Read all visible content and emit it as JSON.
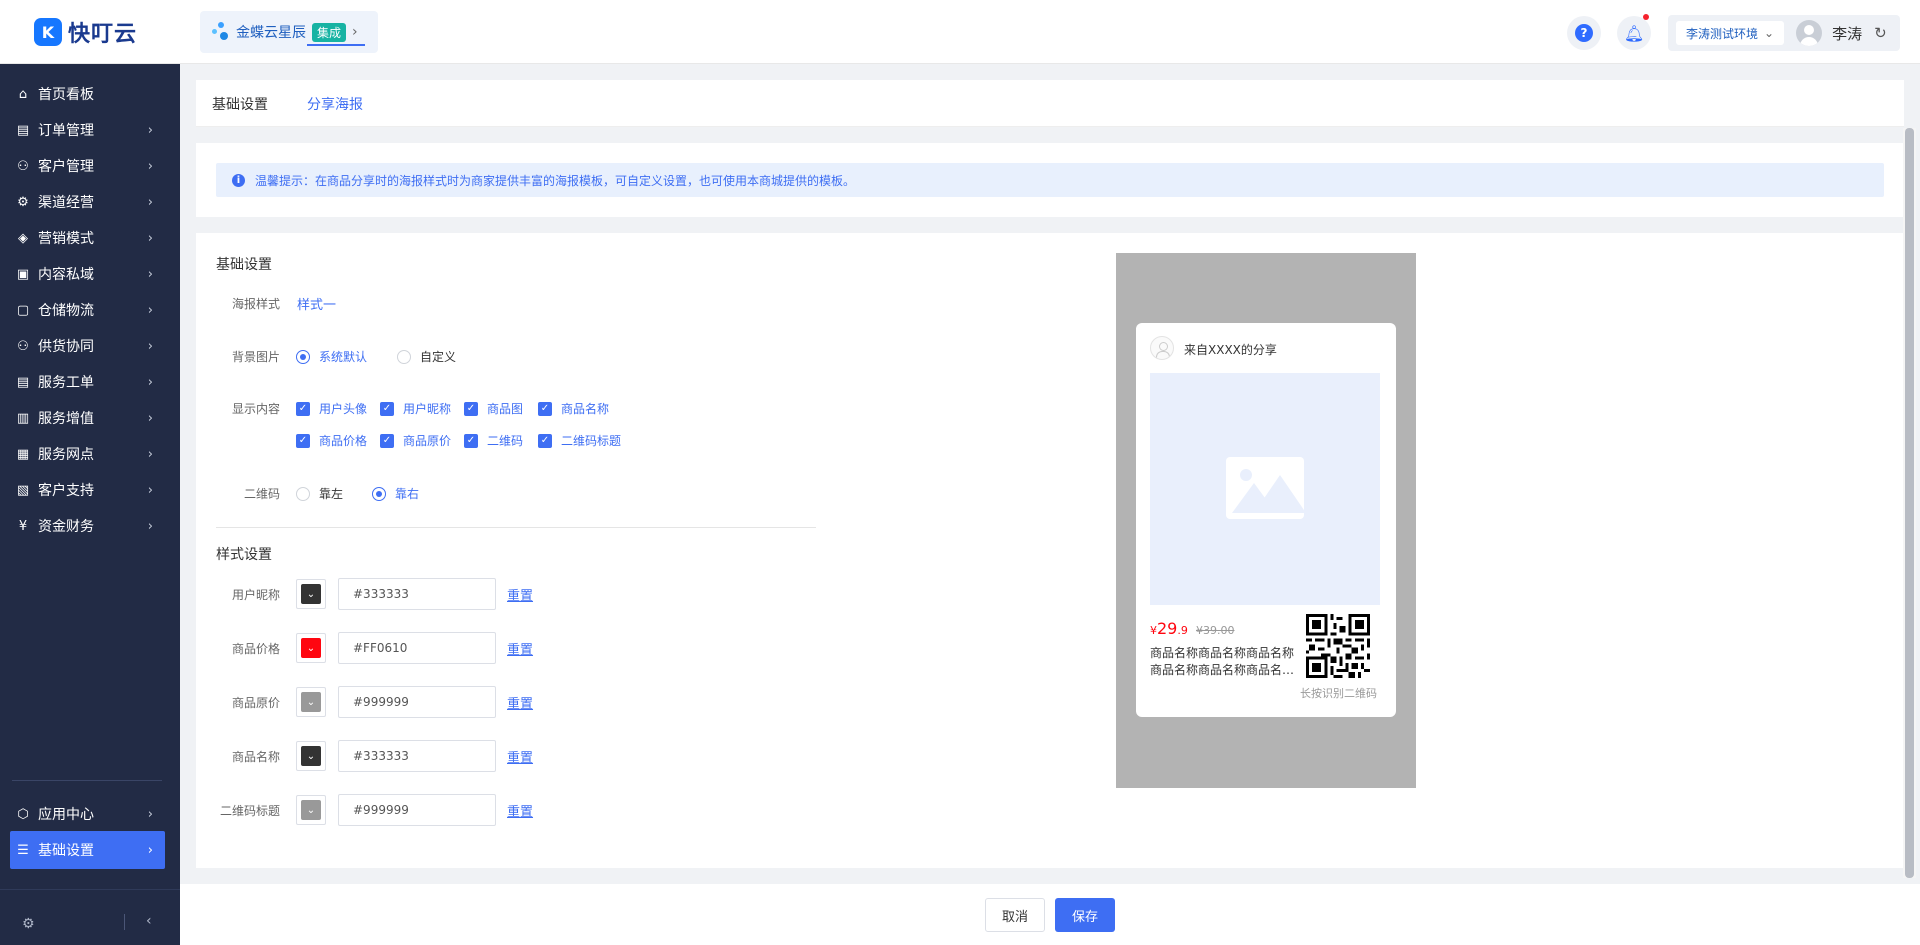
{
  "app": {
    "logo_text": "快叮云",
    "logo_mark": "K"
  },
  "header": {
    "brand_name": "金蝶云星辰",
    "brand_tag": "集成",
    "help_glyph": "?",
    "environment": "李涛测试环境",
    "user_name": "李涛"
  },
  "sidebar": {
    "items": [
      {
        "label": "首页看板",
        "icon": "home-icon",
        "glyph": "⌂",
        "has_arrow": false
      },
      {
        "label": "订单管理",
        "icon": "order-icon",
        "glyph": "▤"
      },
      {
        "label": "客户管理",
        "icon": "user-icon",
        "glyph": "⚇"
      },
      {
        "label": "渠道经营",
        "icon": "channel-icon",
        "glyph": "⚙"
      },
      {
        "label": "营销模式",
        "icon": "tag-icon",
        "glyph": "◈"
      },
      {
        "label": "内容私域",
        "icon": "image-icon",
        "glyph": "▣"
      },
      {
        "label": "仓储物流",
        "icon": "warehouse-icon",
        "glyph": "▢"
      },
      {
        "label": "供货协同",
        "icon": "supply-icon",
        "glyph": "⚇"
      },
      {
        "label": "服务工单",
        "icon": "ticket-icon",
        "glyph": "▤"
      },
      {
        "label": "服务增值",
        "icon": "bag-icon",
        "glyph": "▥"
      },
      {
        "label": "服务网点",
        "icon": "store-icon",
        "glyph": "▦"
      },
      {
        "label": "客户支持",
        "icon": "support-icon",
        "glyph": "▧"
      },
      {
        "label": "资金财务",
        "icon": "finance-icon",
        "glyph": "¥"
      }
    ],
    "bottom_items": [
      {
        "label": "应用中心",
        "icon": "cube-icon",
        "glyph": "⬡"
      },
      {
        "label": "基础设置",
        "icon": "sliders-icon",
        "glyph": "☰",
        "active": true
      }
    ]
  },
  "tabs": [
    {
      "label": "基础设置",
      "active": false
    },
    {
      "label": "分享海报",
      "active": true
    }
  ],
  "tip": {
    "text": "温馨提示：在商品分享时的海报样式时为商家提供丰富的海报模板，可自定义设置，也可使用本商城提供的模板。"
  },
  "basic": {
    "title": "基础设置",
    "poster_style": {
      "label": "海报样式",
      "value": "样式一"
    },
    "background": {
      "label": "背景图片",
      "options": [
        {
          "label": "系统默认",
          "checked": true
        },
        {
          "label": "自定义",
          "checked": false
        }
      ]
    },
    "display": {
      "label": "显示内容",
      "options": [
        "用户头像",
        "用户昵称",
        "商品图",
        "商品名称",
        "商品价格",
        "商品原价",
        "二维码",
        "二维码标题"
      ]
    },
    "qrcode": {
      "label": "二维码",
      "options": [
        {
          "label": "靠左",
          "checked": false
        },
        {
          "label": "靠右",
          "checked": true
        }
      ]
    }
  },
  "style": {
    "title": "样式设置",
    "reset_label": "重置",
    "rows": [
      {
        "label": "用户昵称",
        "color": "#333333",
        "value": "#333333"
      },
      {
        "label": "商品价格",
        "color": "#FF0610",
        "value": "#FF0610"
      },
      {
        "label": "商品原价",
        "color": "#999999",
        "value": "#999999"
      },
      {
        "label": "商品名称",
        "color": "#333333",
        "value": "#333333"
      },
      {
        "label": "二维码标题",
        "color": "#999999",
        "value": "#999999"
      }
    ]
  },
  "poster": {
    "share_text": "来自XXXX的分享",
    "price_currency": "¥",
    "price_int": "29",
    "price_dec": ".9",
    "original_price": "¥39.00",
    "name_line1": "商品名称商品名称商品名称",
    "name_line2": "商品名称商品名称商品名称商品名称",
    "qr_caption": "长按识别二维码"
  },
  "footer": {
    "cancel": "取消",
    "save": "保存"
  },
  "colors": {
    "primary": "#3e6ef3",
    "sidebar_bg": "#222b45",
    "price": "#ff0610"
  }
}
